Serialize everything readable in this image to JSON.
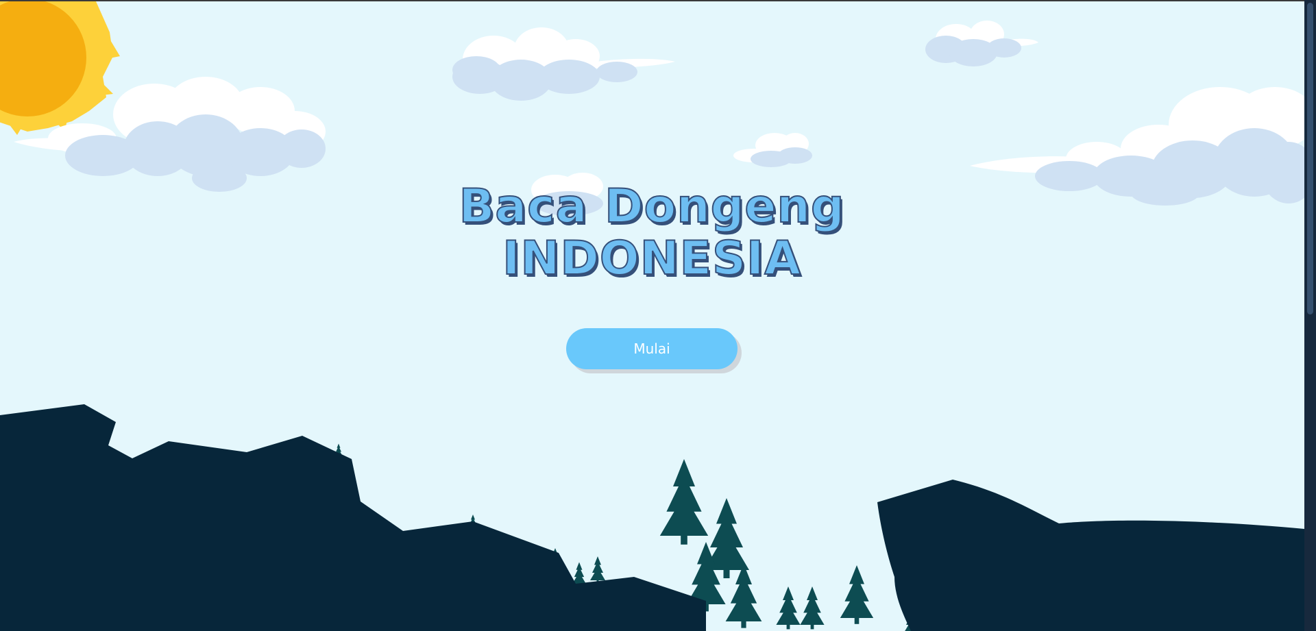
{
  "title": {
    "line1": "Baca Dongeng",
    "line2": "INDONESIA"
  },
  "start_button": {
    "label": "Mulai"
  },
  "colors": {
    "sky": "#e4f7fc",
    "sun_outer": "#fdd13a",
    "sun_inner": "#f5ae10",
    "cloud_white": "#ffffff",
    "cloud_blue": "#cfe1f3",
    "mountain": "#07263a",
    "tree": "#0d4c52",
    "button": "#69c8fb",
    "title_fill": "#6ebef2",
    "title_outline": "#35507a"
  }
}
